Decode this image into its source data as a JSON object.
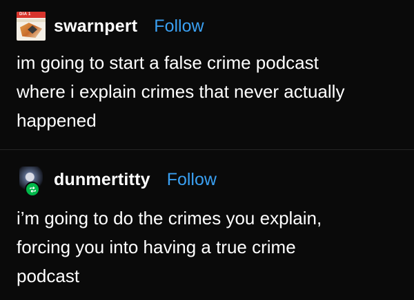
{
  "posts": [
    {
      "username": "swarnpert",
      "follow_label": "Follow",
      "avatar_tag": "DIA 1",
      "lines": [
        "im going to start a false crime podcast",
        "where i explain crimes that never actually",
        "happened"
      ]
    },
    {
      "username": "dunmertitty",
      "follow_label": "Follow",
      "lines": [
        "i’m going to do the crimes you explain,",
        "forcing you into having a true crime",
        "podcast"
      ]
    }
  ],
  "colors": {
    "background": "#000000",
    "text": "#ffffff",
    "follow": "#3aa0f2",
    "reblog_badge": "#00b84a"
  },
  "icons": {
    "reblog_badge": "reblog-icon"
  }
}
